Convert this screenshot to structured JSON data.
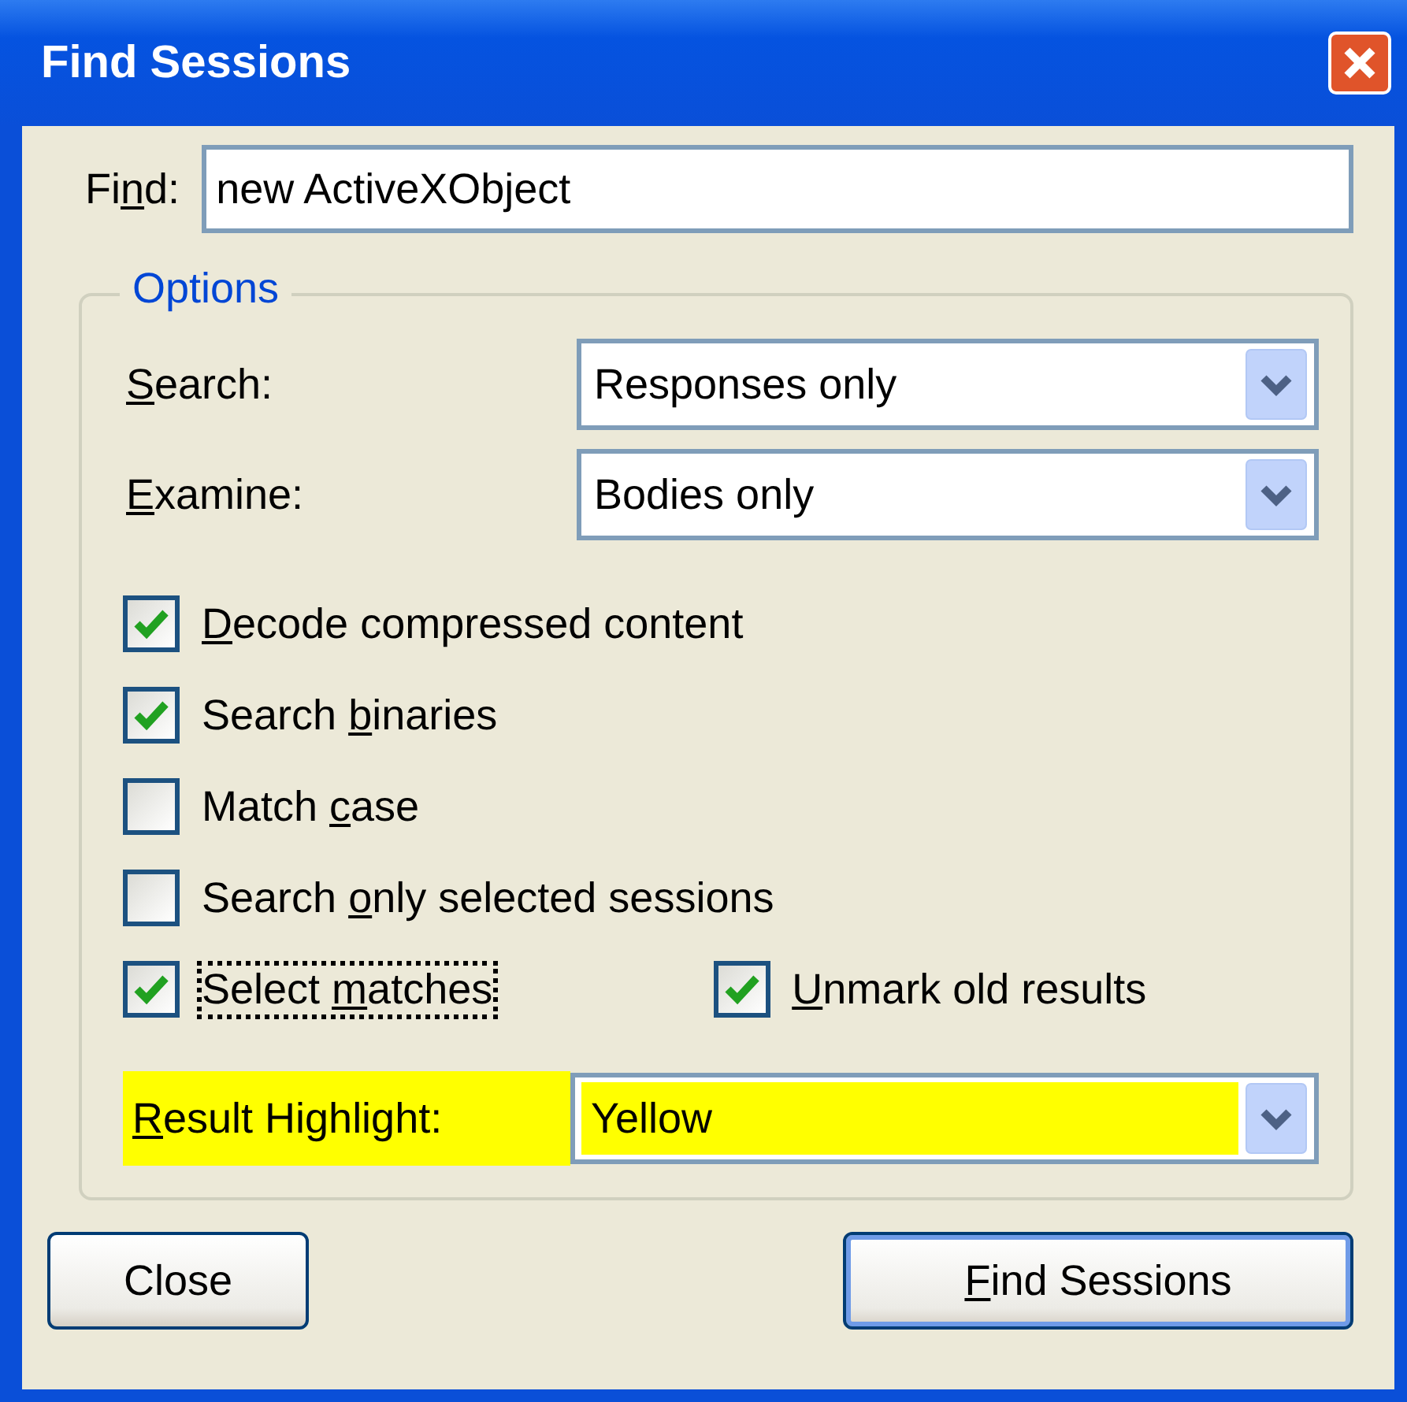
{
  "window": {
    "title": "Find Sessions"
  },
  "find": {
    "label": {
      "pre": "Fi",
      "key": "n",
      "post": "d:"
    },
    "value": "new ActiveXObject"
  },
  "options": {
    "title": "Options",
    "dropdowns": [
      {
        "label": {
          "key": "S",
          "post": "earch:"
        },
        "value": "Responses only"
      },
      {
        "label": {
          "key": "E",
          "post": "xamine:"
        },
        "value": "Bodies only"
      }
    ],
    "checkboxes": [
      {
        "label": {
          "key": "D",
          "post": "ecode compressed content"
        },
        "checked": true,
        "focused": false
      },
      {
        "label": {
          "pre": "Search ",
          "key": "b",
          "post": "inaries"
        },
        "checked": true,
        "focused": false
      },
      {
        "label": {
          "pre": "Match ",
          "key": "c",
          "post": "ase"
        },
        "checked": false,
        "focused": false
      },
      {
        "label": {
          "pre": "Search ",
          "key": "o",
          "post": "nly selected sessions"
        },
        "checked": false,
        "focused": false
      }
    ],
    "paired_checkboxes": [
      {
        "label": {
          "pre": "Select ",
          "key": "m",
          "post": "atches"
        },
        "checked": true,
        "focused": true
      },
      {
        "label": {
          "key": "U",
          "post": "nmark old results"
        },
        "checked": true,
        "focused": false
      }
    ],
    "result_highlight": {
      "label": {
        "key": "R",
        "post": "esult Highlight:"
      },
      "value": "Yellow",
      "color": "#ffff00"
    }
  },
  "buttons": [
    {
      "label": {
        "pre": "Close"
      },
      "default": false
    },
    {
      "label": {
        "key": "F",
        "post": "ind Sessions"
      },
      "default": true
    }
  ]
}
